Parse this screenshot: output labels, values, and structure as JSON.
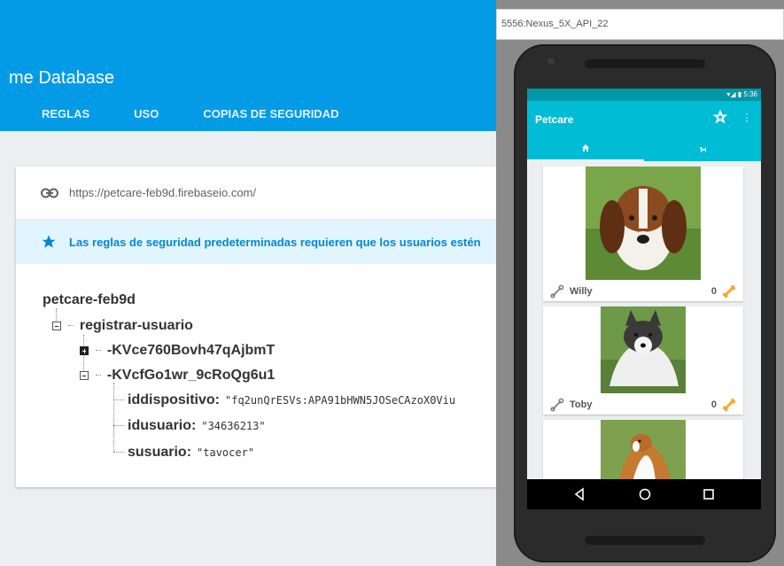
{
  "console": {
    "title": "me Database",
    "tabs": [
      "REGLAS",
      "USO",
      "COPIAS DE SEGURIDAD"
    ],
    "url": "https://petcare-feb9d.firebaseio.com/",
    "notice": "Las reglas de seguridad predeterminadas requieren que los usuarios estén",
    "tree": {
      "root": "petcare-feb9d",
      "child": "registrar-usuario",
      "collapsed_key": "-KVce760Bovh47qAjbmT",
      "expanded_key": "-KVcfGo1wr_9cRoQg6u1",
      "fields": [
        {
          "key": "iddispositivo:",
          "value": "\"fq2unQrESVs:APA91bHWN5JOSeCAzoX0Viu"
        },
        {
          "key": "idusuario:",
          "value": "\"34636213\""
        },
        {
          "key": "susuario:",
          "value": "\"tavocer\""
        }
      ]
    }
  },
  "emulator": {
    "window_title": "5556:Nexus_5X_API_22",
    "status_time": "5:36",
    "app_title": "Petcare",
    "dogs": [
      {
        "name": "Willy",
        "count": "0"
      },
      {
        "name": "Toby",
        "count": "0"
      },
      {
        "name": "",
        "count": ""
      }
    ]
  },
  "colors": {
    "firebase_blue": "#039be5",
    "app_primary": "#00bcd4",
    "app_status": "#0097a7",
    "notice_text": "#0288d1",
    "bone": "#f9a825"
  }
}
